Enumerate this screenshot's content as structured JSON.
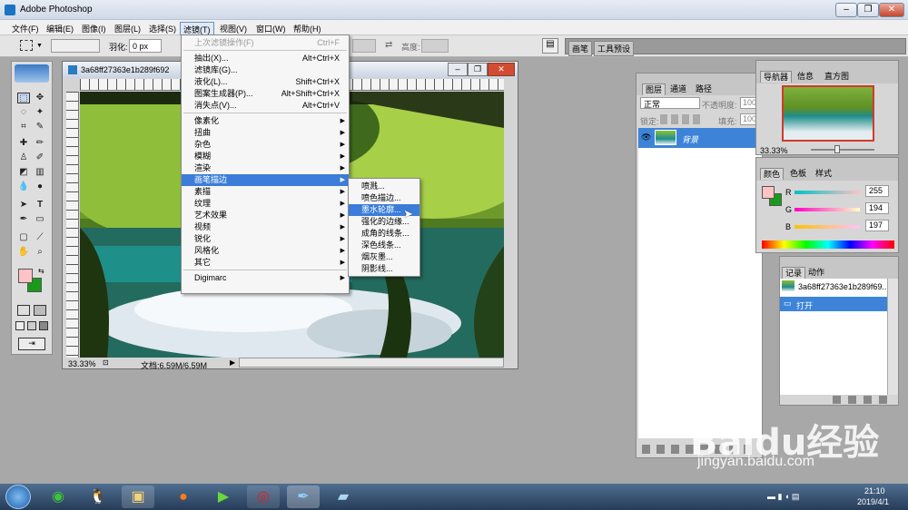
{
  "app": {
    "title": "Adobe Photoshop"
  },
  "menubar": [
    "文件(F)",
    "编辑(E)",
    "图像(I)",
    "图层(L)",
    "选择(S)",
    "滤镜(T)",
    "视图(V)",
    "窗口(W)",
    "帮助(H)"
  ],
  "options": {
    "feather_label": "羽化:",
    "feather_value": "0 px",
    "height_label": "高度:",
    "brush_tab": "画笔",
    "presets_tab": "工具预设"
  },
  "document": {
    "title": "3a68ff27363e1b289f692",
    "zoom": "33.33%",
    "doc_info": "文档:6.59M/6.59M"
  },
  "filter_menu": {
    "items": [
      {
        "label": "上次滤镜操作(F)",
        "shortcut": "Ctrl+F",
        "disabled": true
      },
      {
        "label": "抽出(X)...",
        "shortcut": "Alt+Ctrl+X"
      },
      {
        "label": "滤镜库(G)...",
        "shortcut": ""
      },
      {
        "label": "液化(L)...",
        "shortcut": "Shift+Ctrl+X"
      },
      {
        "label": "图案生成器(P)...",
        "shortcut": "Alt+Shift+Ctrl+X"
      },
      {
        "label": "消失点(V)...",
        "shortcut": "Alt+Ctrl+V"
      },
      {
        "label": "像素化",
        "sub": true
      },
      {
        "label": "扭曲",
        "sub": true
      },
      {
        "label": "杂色",
        "sub": true
      },
      {
        "label": "模糊",
        "sub": true
      },
      {
        "label": "渲染",
        "sub": true
      },
      {
        "label": "画笔描边",
        "sub": true,
        "highlight": true
      },
      {
        "label": "素描",
        "sub": true
      },
      {
        "label": "纹理",
        "sub": true
      },
      {
        "label": "艺术效果",
        "sub": true
      },
      {
        "label": "视频",
        "sub": true
      },
      {
        "label": "锐化",
        "sub": true
      },
      {
        "label": "风格化",
        "sub": true
      },
      {
        "label": "其它",
        "sub": true
      },
      {
        "label": "Digimarc",
        "sub": true
      }
    ]
  },
  "brush_submenu": [
    "喷溅...",
    "喷色描边...",
    "墨水轮廓...",
    "强化的边缘...",
    "成角的线条...",
    "深色线条...",
    "烟灰墨...",
    "阴影线..."
  ],
  "brush_submenu_highlight": 2,
  "layers_panel": {
    "tabs": [
      "图层",
      "通道",
      "路径"
    ],
    "blend_mode": "正常",
    "opacity_label": "不透明度:",
    "opacity_value": "100",
    "lock_label": "锁定:",
    "fill_label": "填充:",
    "fill_value": "100",
    "layer_name": "背景"
  },
  "navigator_panel": {
    "tabs": [
      "导航器",
      "信息",
      "直方图"
    ],
    "zoom": "33.33%"
  },
  "color_panel": {
    "tabs": [
      "颜色",
      "色板",
      "样式"
    ],
    "r_label": "R",
    "g_label": "G",
    "b_label": "B",
    "r": "255",
    "g": "194",
    "b": "197",
    "swatch": "#ffc2c5"
  },
  "history_panel": {
    "tabs": [
      "记录",
      "动作"
    ],
    "snapshot": "3a68ff27363e1b289f69...",
    "step": "打开"
  },
  "taskbar": {
    "time": "21:10",
    "date": "2019/4/1"
  },
  "watermark": {
    "brand": "Baidu经验",
    "url": "jingyan.baidu.com"
  }
}
